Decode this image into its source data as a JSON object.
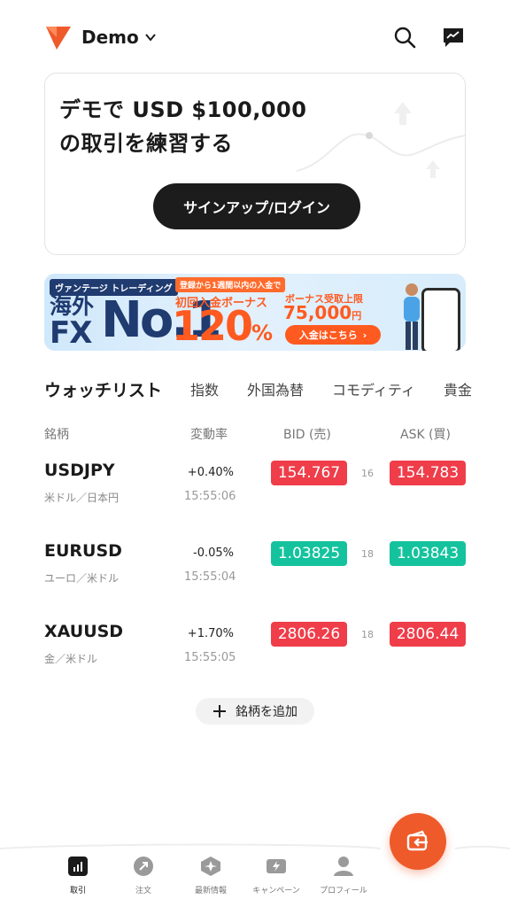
{
  "header": {
    "account_label": "Demo"
  },
  "promo": {
    "title_line1": "デモで USD $100,000",
    "title_line2": "の取引を練習する",
    "button_label": "サインアップ/ログイン"
  },
  "banner": {
    "tag": "ヴァンテージ トレーディング",
    "big_text_1": "海外",
    "big_text_2": "FX",
    "no1": "No.1",
    "tag2": "登録から1週間以内の入金で",
    "bonus_label": "初回入金ボーナス",
    "percent": "120",
    "percent_unit": "%",
    "limit_label": "ボーナス受取上限",
    "limit_value": "75,000",
    "limit_unit": "円",
    "cta": "入金はこちら"
  },
  "tabs": [
    {
      "label": "ウォッチリスト",
      "active": true
    },
    {
      "label": "指数"
    },
    {
      "label": "外国為替"
    },
    {
      "label": "コモディティ"
    },
    {
      "label": "貴金"
    }
  ],
  "columns": {
    "symbol": "銘柄",
    "change": "変動率",
    "bid": "BID (売)",
    "ask": "ASK (買)"
  },
  "watchlist": [
    {
      "symbol": "USDJPY",
      "subtitle": "米ドル／日本円",
      "change": "+0.40%",
      "time": "15:55:06",
      "bid": "154.767",
      "spread": "16",
      "ask": "154.783",
      "bid_color": "red",
      "ask_color": "red"
    },
    {
      "symbol": "EURUSD",
      "subtitle": "ユーロ／米ドル",
      "change": "-0.05%",
      "time": "15:55:04",
      "bid": "1.03825",
      "spread": "18",
      "ask": "1.03843",
      "bid_color": "green",
      "ask_color": "green"
    },
    {
      "symbol": "XAUUSD",
      "subtitle": "金／米ドル",
      "change": "+1.70%",
      "time": "15:55:05",
      "bid": "2806.26",
      "spread": "18",
      "ask": "2806.44",
      "bid_color": "red",
      "ask_color": "red"
    }
  ],
  "add_symbol_label": "銘柄を追加",
  "nav": [
    {
      "label": "取引",
      "icon": "bar-chart-icon",
      "active": true
    },
    {
      "label": "注文",
      "icon": "order-icon"
    },
    {
      "label": "最新情報",
      "icon": "news-icon"
    },
    {
      "label": "キャンペーン",
      "icon": "campaign-icon"
    },
    {
      "label": "プロフィール",
      "icon": "profile-icon"
    }
  ],
  "colors": {
    "brand": "#ef5a2a",
    "price_up": "#ef3d4a",
    "price_down": "#14c39d"
  }
}
